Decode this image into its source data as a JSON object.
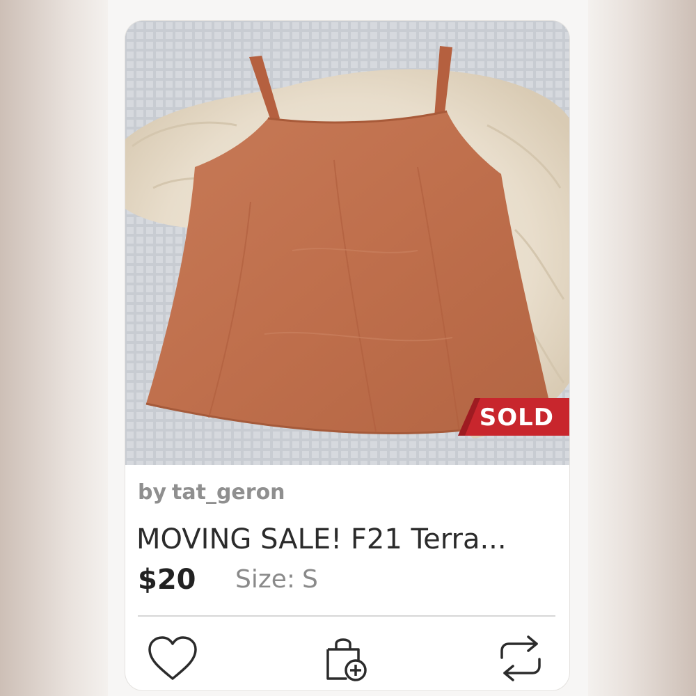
{
  "listing": {
    "badge": "SOLD",
    "seller_prefix": "by",
    "seller": "tat_geron",
    "title": "MOVING SALE! F21 Terra...",
    "price": "$20",
    "size_label": "Size:",
    "size_value": "S"
  },
  "actions": {
    "like_icon": "heart-icon",
    "bundle_icon": "shopping-bag-add-icon",
    "share_icon": "share-repeat-icon"
  },
  "colors": {
    "badge_red": "#c8262d",
    "garment_rust": "#c0714f",
    "text_dark": "#2b2b2b",
    "text_muted": "#8f8f8f"
  }
}
